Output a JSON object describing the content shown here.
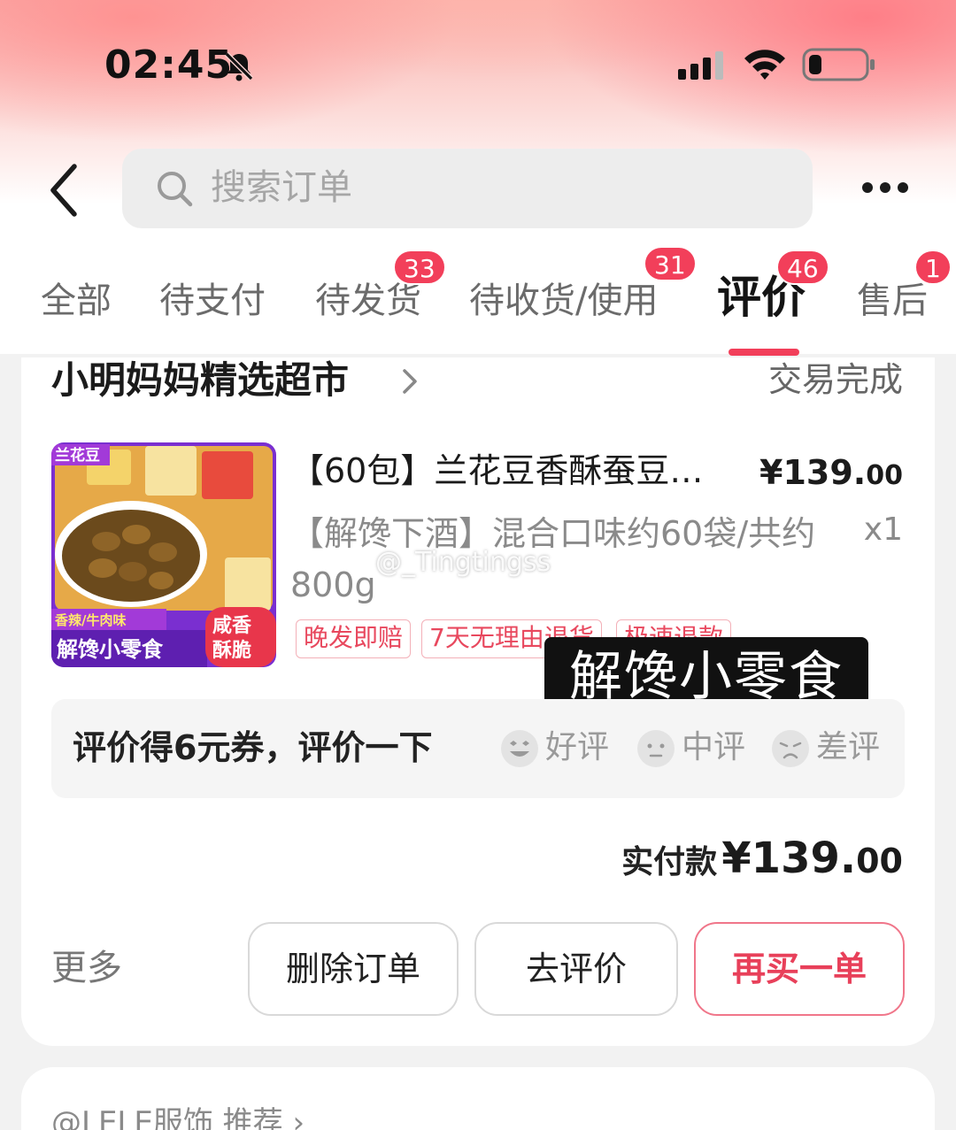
{
  "status_bar": {
    "time": "02:45"
  },
  "header": {
    "search_placeholder": "搜索订单"
  },
  "tabs": [
    {
      "label": "全部"
    },
    {
      "label": "待支付"
    },
    {
      "label": "待发货",
      "badge": "33"
    },
    {
      "label": "待收货/使用",
      "badge": "31"
    },
    {
      "label": "评价",
      "badge": "46",
      "active": true
    },
    {
      "label": "售后",
      "badge": "1"
    }
  ],
  "order": {
    "shop_name": "小明妈妈精选超市",
    "status": "交易完成",
    "product": {
      "title": "【60包】兰花豆香酥蚕豆…",
      "price_main": "¥139.",
      "price_cents": "00",
      "spec": "【解馋下酒】混合口味约60袋/共约800g",
      "quantity": "x1",
      "image_text": {
        "brand": "兰花豆",
        "flavor": "香辣/牛肉味",
        "slogan": "解馋小零食",
        "badge": "咸香酥脆"
      }
    },
    "tags": [
      "晚发即赔",
      "7天无理由退货",
      "极速退款"
    ],
    "watermark": "@_Tingtingss",
    "overlay_caption": "解馋小零食",
    "review_prompt": "评价得6元券，评价一下",
    "ratings": [
      "好评",
      "中评",
      "差评"
    ],
    "paid_label": "实付款",
    "paid_amount_main": "¥139.",
    "paid_amount_cents": "00",
    "more_label": "更多",
    "buttons": {
      "delete": "删除订单",
      "review": "去评价",
      "rebuy": "再买一单"
    }
  },
  "recommend": {
    "text": "@LELE服饰 推荐 ›"
  },
  "colors": {
    "accent": "#f23f5a",
    "background": "#f2f2f2",
    "card": "#ffffff"
  }
}
